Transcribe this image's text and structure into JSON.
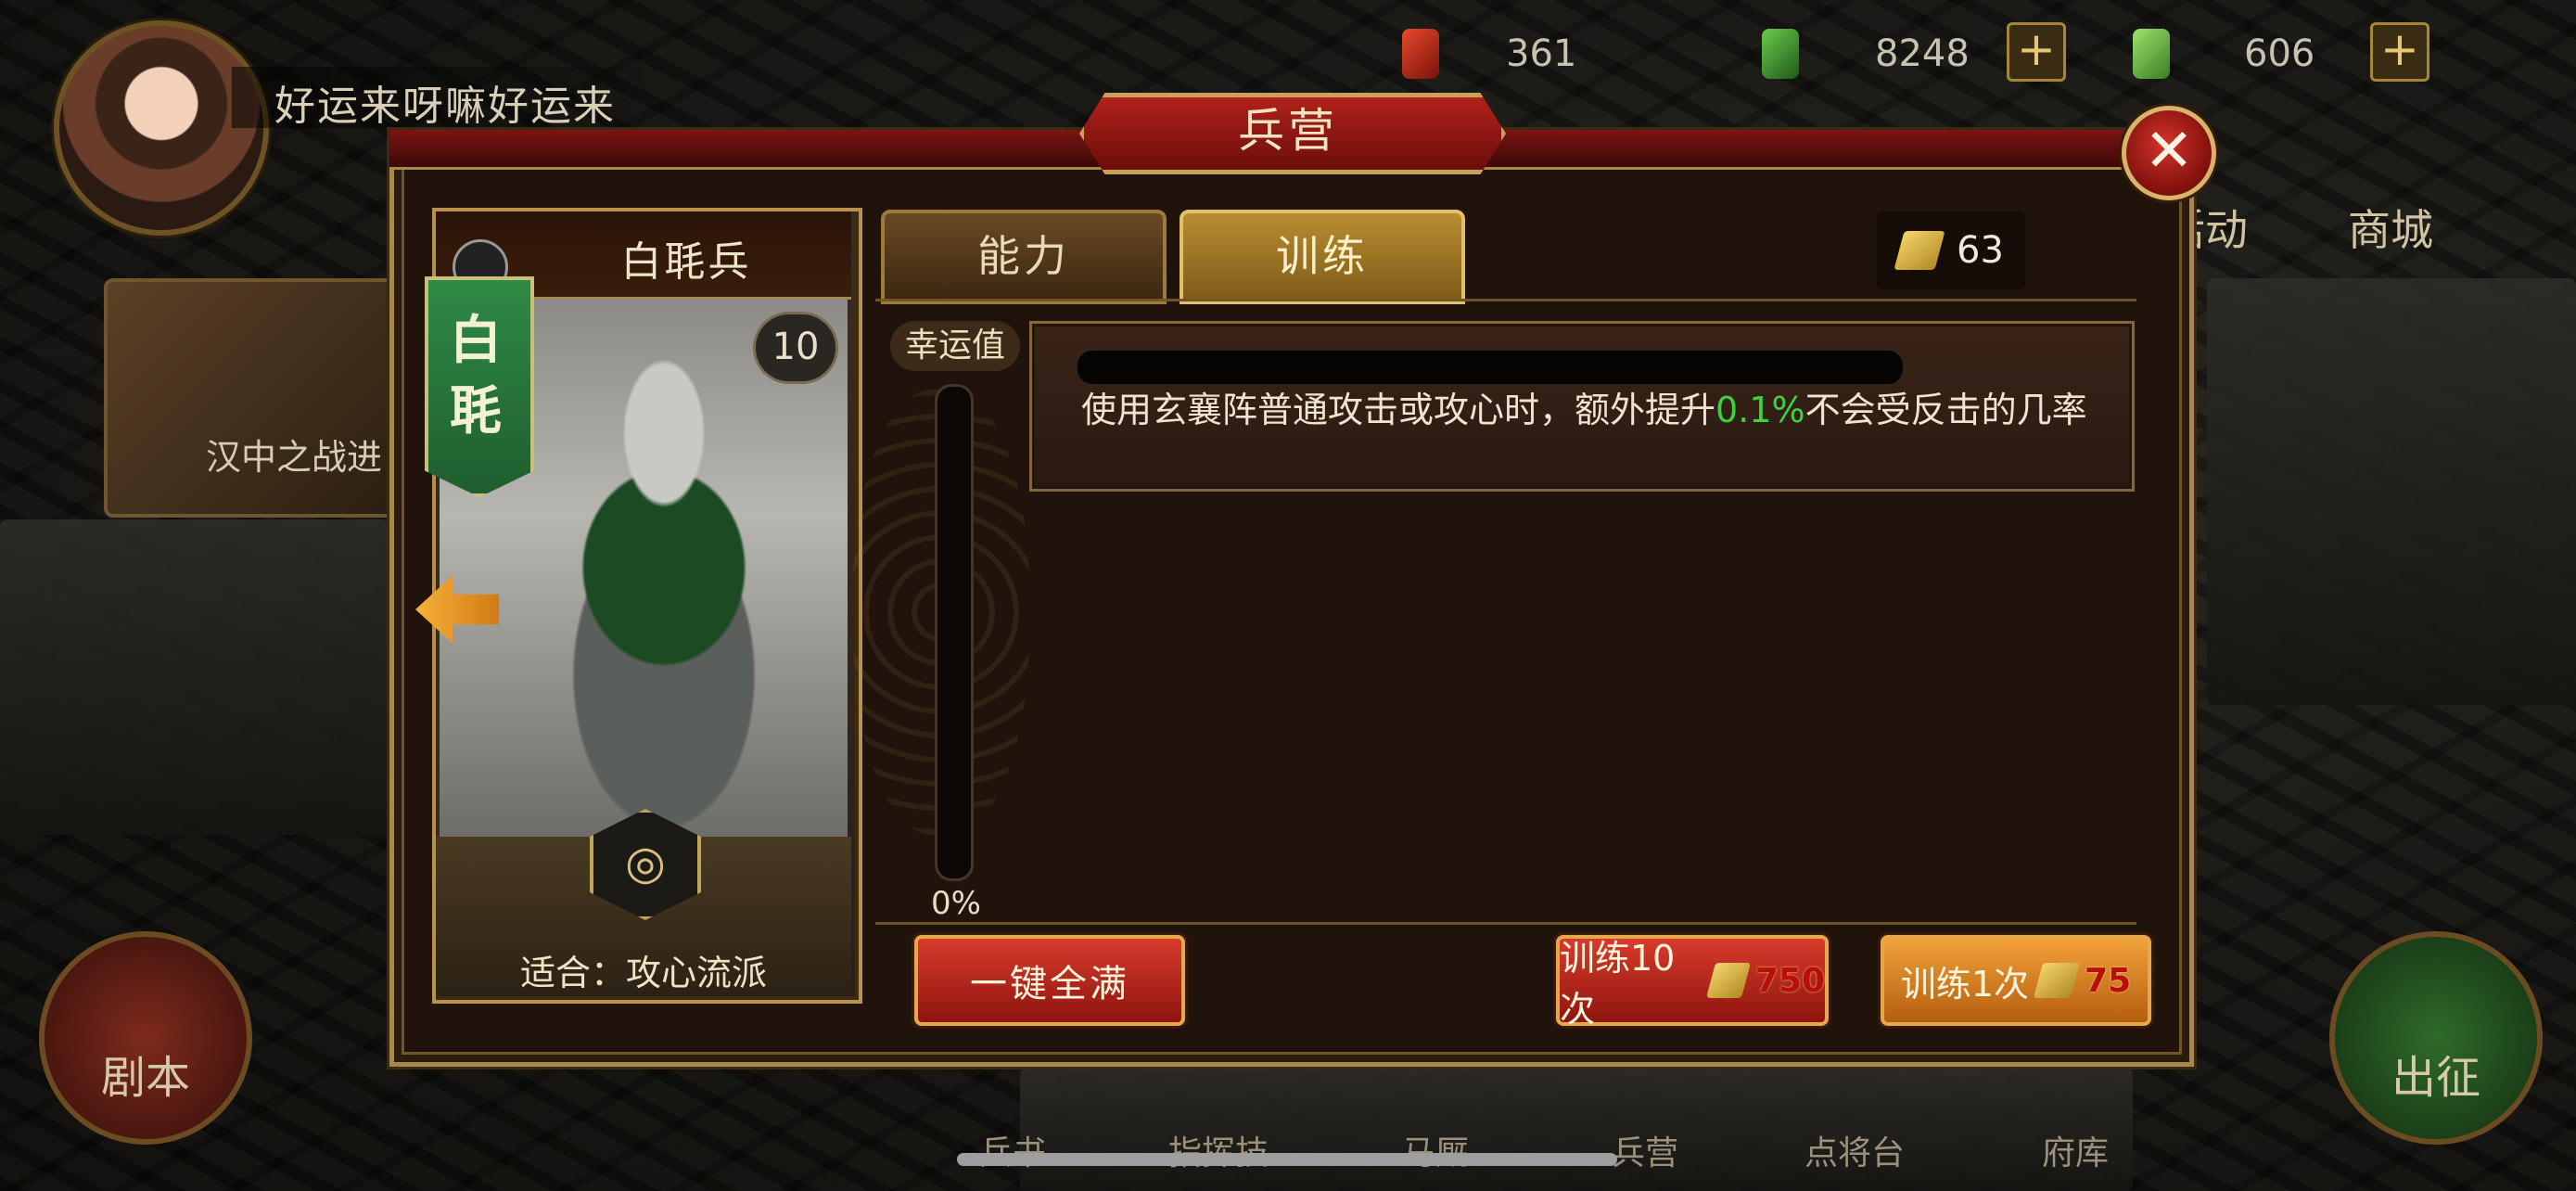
{
  "hud": {
    "player_name": "好运来呀嘛好运来",
    "resources": [
      {
        "icon": "red-token-icon",
        "value": "361"
      },
      {
        "icon": "jade-icon",
        "value": "8248"
      },
      {
        "icon": "green-gem-icon",
        "value": "606"
      }
    ],
    "plus": "+",
    "side_menu": [
      "活动",
      "商城"
    ],
    "left_event_label": "汉中之战进",
    "bottom_nav": [
      "兵书",
      "指挥技",
      "马厩",
      "兵营",
      "点将台",
      "府库"
    ],
    "script_button": "剧本",
    "expedition_button": "出征"
  },
  "dialog": {
    "title": "兵营",
    "close_symbol": "✕",
    "unit": {
      "name": "白毦兵",
      "banner_text": "白毦",
      "level": "10",
      "suitable_label": "适合：攻心流派"
    },
    "tabs": {
      "ability": "能力",
      "training": "训练"
    },
    "currency": {
      "icon": "gold-ticket-icon",
      "amount": "63"
    },
    "luck": {
      "label": "幸运值",
      "percent_text": "0%",
      "value": 0
    },
    "effect": {
      "progress": 0,
      "text_before": "使用玄襄阵普通攻击或攻心时，额外提升",
      "value": "0.1%",
      "text_after": "不会受反击的几率"
    },
    "buttons": {
      "fill_all": "一键全满",
      "train_10": "训练10次",
      "train_10_cost": "750",
      "train_1": "训练1次",
      "train_1_cost": "75"
    }
  },
  "colors": {
    "accent_gold": "#e4b440",
    "effect_value_green": "#3ad43a",
    "cost_red": "#b90f0a",
    "button_red": "#d93b2b"
  }
}
